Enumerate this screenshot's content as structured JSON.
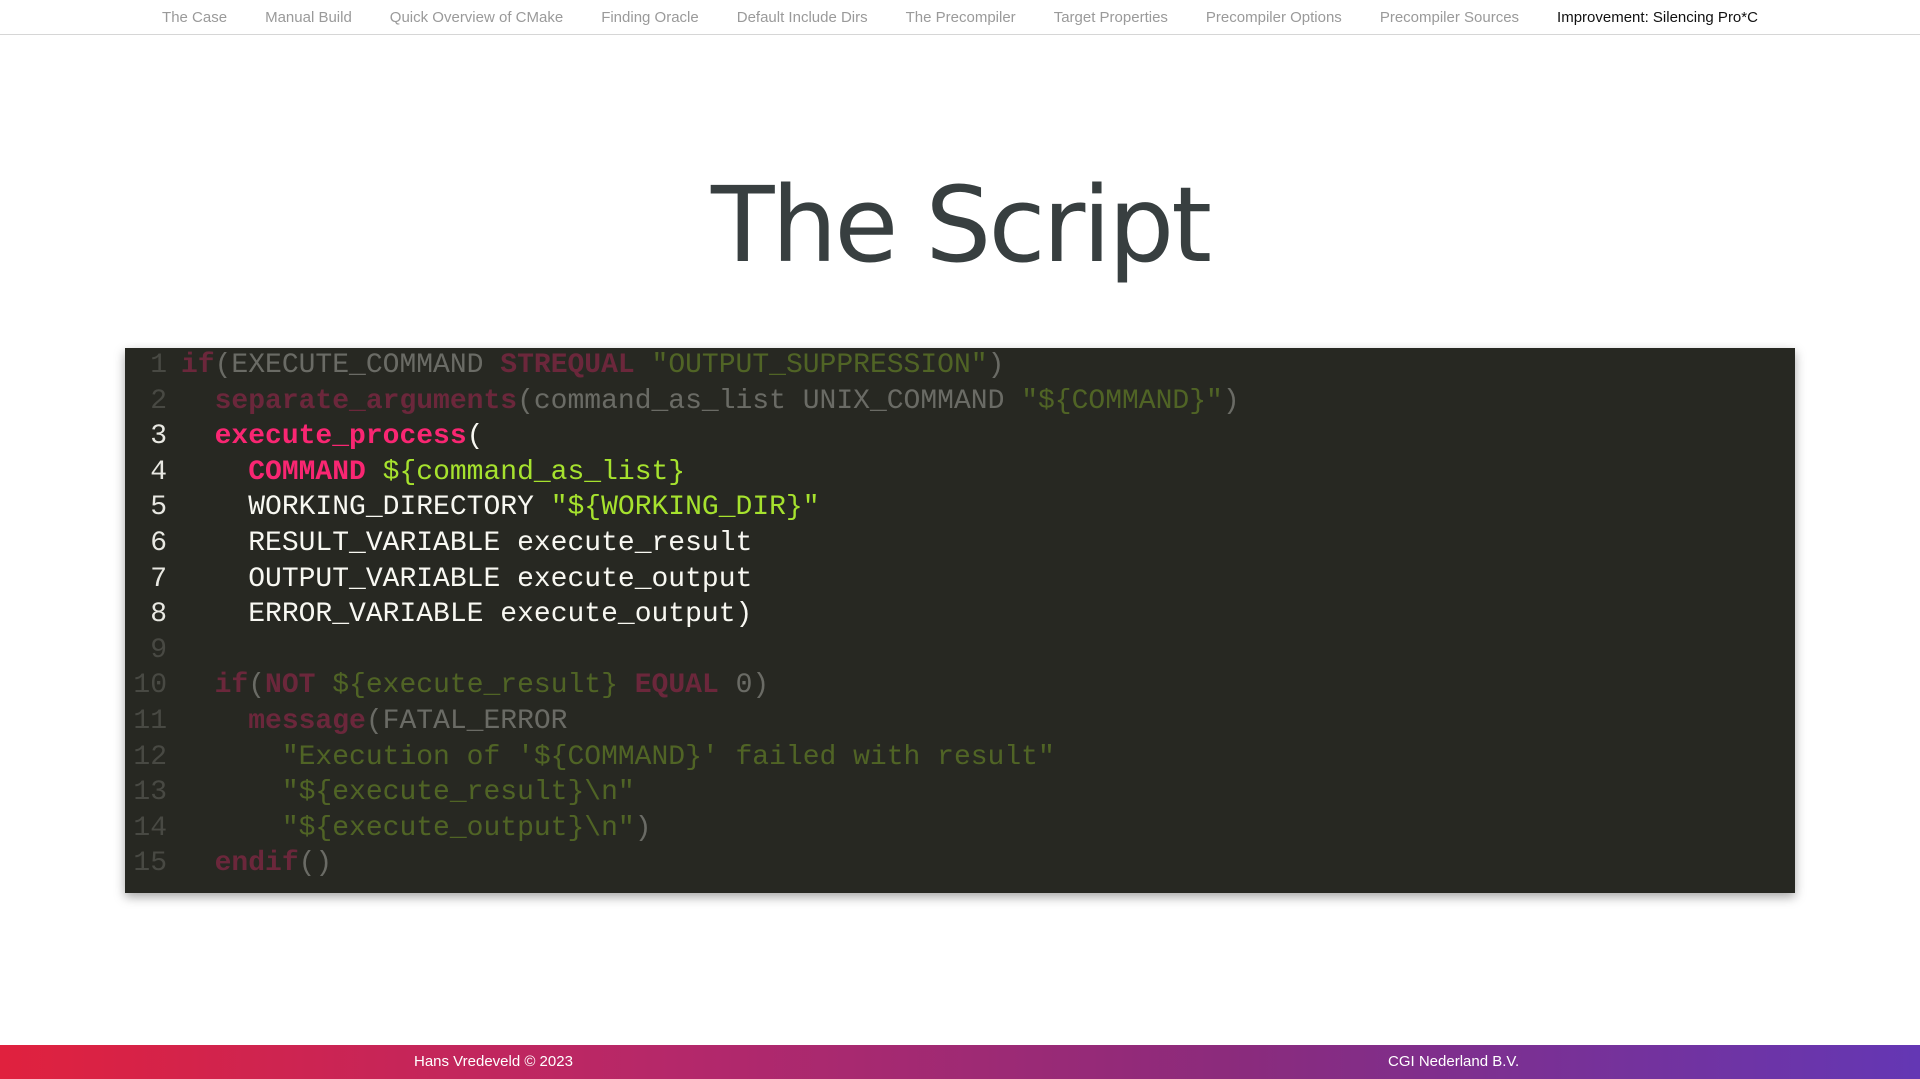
{
  "nav": {
    "items": [
      {
        "label": "The Case"
      },
      {
        "label": "Manual Build"
      },
      {
        "label": "Quick Overview of CMake"
      },
      {
        "label": "Finding Oracle"
      },
      {
        "label": "Default Include Dirs"
      },
      {
        "label": "The Precompiler"
      },
      {
        "label": "Target Properties"
      },
      {
        "label": "Precompiler Options"
      },
      {
        "label": "Precompiler Sources"
      },
      {
        "label": "Improvement: Silencing Pro*C"
      }
    ],
    "active_index": 9
  },
  "slide": {
    "title": "The Script"
  },
  "code": {
    "language": "cmake",
    "highlighted_lines": [
      3,
      4,
      5,
      6,
      7,
      8
    ],
    "lines": [
      {
        "num": "1",
        "text": "if(EXECUTE_COMMAND STREQUAL \"OUTPUT_SUPPRESSION\")"
      },
      {
        "num": "2",
        "text": "  separate_arguments(command_as_list UNIX_COMMAND \"${COMMAND}\")"
      },
      {
        "num": "3",
        "text": "  execute_process("
      },
      {
        "num": "4",
        "text": "    COMMAND ${command_as_list}"
      },
      {
        "num": "5",
        "text": "    WORKING_DIRECTORY \"${WORKING_DIR}\""
      },
      {
        "num": "6",
        "text": "    RESULT_VARIABLE execute_result"
      },
      {
        "num": "7",
        "text": "    OUTPUT_VARIABLE execute_output"
      },
      {
        "num": "8",
        "text": "    ERROR_VARIABLE execute_output)"
      },
      {
        "num": "9",
        "text": ""
      },
      {
        "num": "10",
        "text": "  if(NOT ${execute_result} EQUAL 0)"
      },
      {
        "num": "11",
        "text": "    message(FATAL_ERROR"
      },
      {
        "num": "12",
        "text": "      \"Execution of '${COMMAND}' failed with result\""
      },
      {
        "num": "13",
        "text": "      \"${execute_result}\\n\""
      },
      {
        "num": "14",
        "text": "      \"${execute_output}\\n\")"
      },
      {
        "num": "15",
        "text": "  endif()"
      }
    ]
  },
  "footer": {
    "left": "Hans Vredeveld © 2023",
    "right": "CGI Nederland B.V."
  },
  "colors": {
    "code_background": "#272822",
    "keyword": "#f92672",
    "string": "#a6e22e",
    "footer_gradient_start": "#e0213e",
    "footer_gradient_end": "#6437b4",
    "title": "#383f40"
  }
}
